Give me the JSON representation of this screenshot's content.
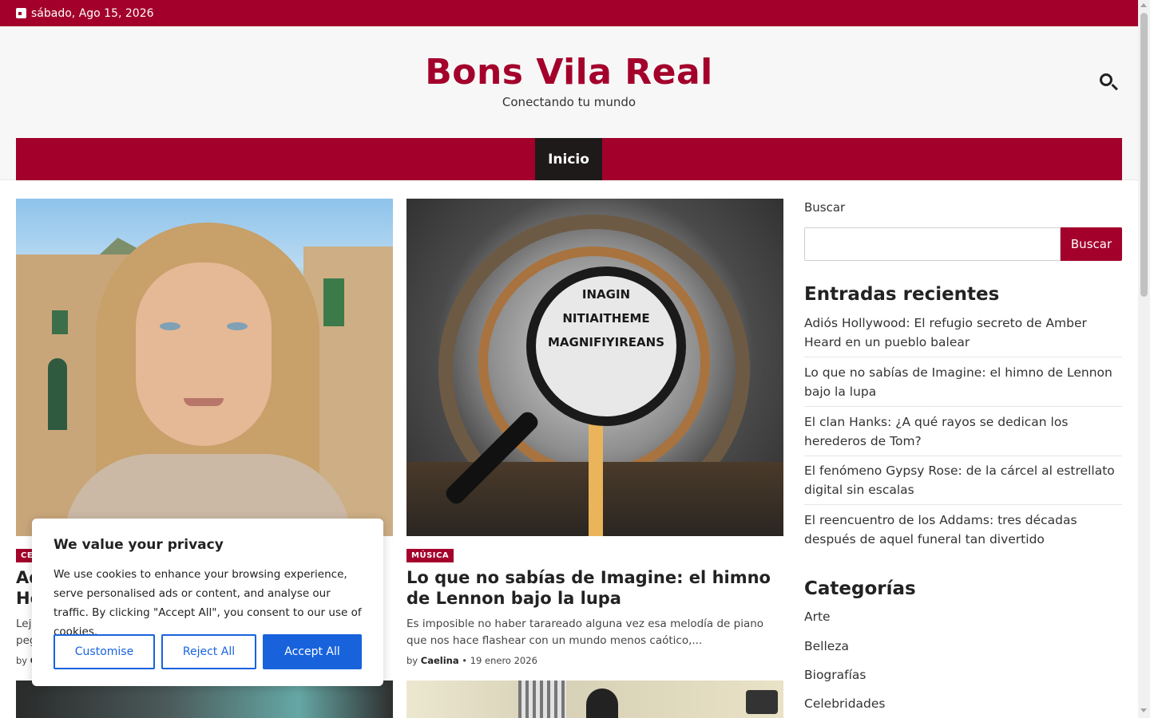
{
  "topbar": {
    "date": "sábado, Ago 15, 2026"
  },
  "header": {
    "title": "Bons Vila Real",
    "tagline": "Conectando tu mundo"
  },
  "nav": {
    "items": [
      {
        "label": "Inicio"
      }
    ]
  },
  "posts": [
    {
      "category": "CE",
      "title_lines": [
        "Ad",
        "Ho"
      ],
      "excerpt_lines": [
        "Lej",
        "peg"
      ],
      "meta_by": "by",
      "meta_author": "C"
    },
    {
      "category": "MÚSICA",
      "title": "Lo que no sabías de Imagine: el himno de Lennon bajo la lupa",
      "excerpt": "Es imposible no haber tarareado alguna vez esa melodía de piano que nos hace flashear con un mundo menos caótico,...",
      "meta_by": "by",
      "meta_author": "Caelina",
      "meta_sep": "•",
      "meta_date": "19 enero 2026",
      "image_text": [
        "INAGIN",
        "NITIAITHEME",
        "MAGNIFIYIREANS"
      ]
    }
  ],
  "sidebar": {
    "search_label": "Buscar",
    "search_button": "Buscar",
    "recent_heading": "Entradas recientes",
    "recent": [
      "Adiós Hollywood: El refugio secreto de Amber Heard en un pueblo balear",
      "Lo que no sabías de Imagine: el himno de Lennon bajo la lupa",
      "El clan Hanks: ¿A qué rayos se dedican los herederos de Tom?",
      "El fenómeno Gypsy Rose: de la cárcel al estrellato digital sin escalas",
      "El reencuentro de los Addams: tres décadas después de aquel funeral tan divertido"
    ],
    "categories_heading": "Categorías",
    "categories": [
      "Arte",
      "Belleza",
      "Biografías",
      "Celebridades"
    ]
  },
  "cookie": {
    "title": "We value your privacy",
    "text": "We use cookies to enhance your browsing experience, serve personalised ads or content, and analyse our traffic. By clicking \"Accept All\", you consent to our use of cookies.",
    "customise": "Customise",
    "reject": "Reject All",
    "accept": "Accept All"
  },
  "colors": {
    "brand": "#a3002b",
    "nav_active": "#1e1a1a",
    "cookie_accent": "#1863dc"
  },
  "icons": {
    "date": "calendar-icon",
    "search": "search-icon"
  }
}
